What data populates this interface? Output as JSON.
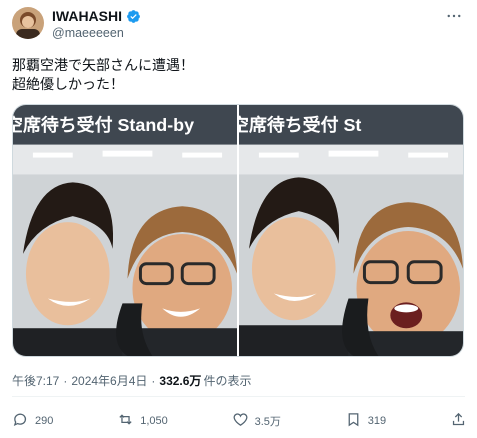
{
  "author": {
    "display_name": "IWAHASHI",
    "handle": "@maeeeeen",
    "verified": true,
    "verified_color": "#1d9bf0"
  },
  "tweet": {
    "lines": [
      "那覇空港で矢部さんに遭遇！",
      "超絶優しかった！"
    ]
  },
  "media": {
    "photos": [
      {
        "sign_text": "空席待ち受付 Stand-by"
      },
      {
        "sign_text": "空席待ち受付 St"
      }
    ]
  },
  "meta": {
    "time": "午後7:17",
    "date": "2024年6月4日",
    "views_count": "332.6万",
    "views_label": "件の表示"
  },
  "actions": {
    "replies": "290",
    "reposts": "1,050",
    "likes": "3.5万",
    "bookmarks": "319"
  },
  "colors": {
    "text": "#0f1419",
    "secondary": "#536471",
    "accent": "#1d9bf0"
  },
  "icons": {
    "more": "more-icon",
    "reply": "reply-icon",
    "repost": "repost-icon",
    "like": "like-icon",
    "bookmark": "bookmark-icon",
    "share": "share-icon"
  }
}
